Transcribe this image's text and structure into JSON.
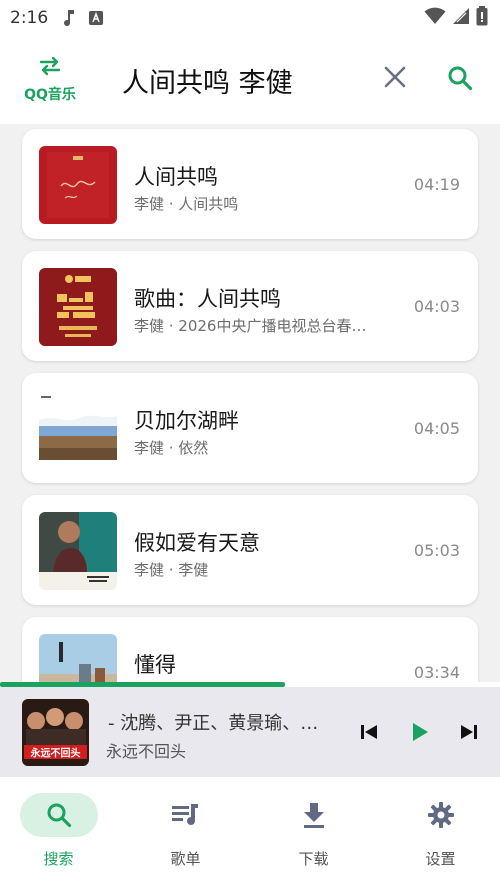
{
  "status_bar": {
    "time": "2:16",
    "icons": [
      "music-note-icon",
      "app-a-icon",
      "wifi-icon",
      "signal-icon",
      "battery-icon"
    ]
  },
  "header": {
    "logo_label": "QQ音乐",
    "logo_icon": "swap-arrows-icon",
    "search_value": "人间共鸣 李健",
    "clear_icon": "close-icon",
    "search_icon": "search-icon"
  },
  "songs": [
    {
      "title": "人间共鸣",
      "subtitle": "李健 · 人间共鸣",
      "duration": "04:19"
    },
    {
      "title": "歌曲：人间共鸣",
      "subtitle": "李健 · 2026中央广播电视总台春…",
      "duration": "04:03"
    },
    {
      "title": "贝加尔湖畔",
      "subtitle": "李健 · 依然",
      "duration": "04:05"
    },
    {
      "title": "假如爱有天意",
      "subtitle": "李健 · 李健",
      "duration": "05:03"
    },
    {
      "title": "懂得",
      "subtitle": "",
      "duration": "03:34"
    }
  ],
  "playback": {
    "progress_fraction": 0.57
  },
  "now_playing": {
    "title": " - 沈腾、尹正、黄景瑜、…",
    "subtitle": "永远不回头",
    "cover_text": "永远不回头"
  },
  "controls": {
    "prev_icon": "skip-previous-icon",
    "play_icon": "play-icon",
    "next_icon": "skip-next-icon"
  },
  "nav": [
    {
      "label": "搜索",
      "icon": "search-icon",
      "active": true
    },
    {
      "label": "歌单",
      "icon": "playlist-icon",
      "active": false
    },
    {
      "label": "下载",
      "icon": "download-icon",
      "active": false
    },
    {
      "label": "设置",
      "icon": "gear-icon",
      "active": false
    }
  ],
  "colors": {
    "accent": "#1aa260",
    "accent_light": "#d9f1e2",
    "background": "#f1f1f1",
    "player_bg": "#e9e8ee"
  }
}
